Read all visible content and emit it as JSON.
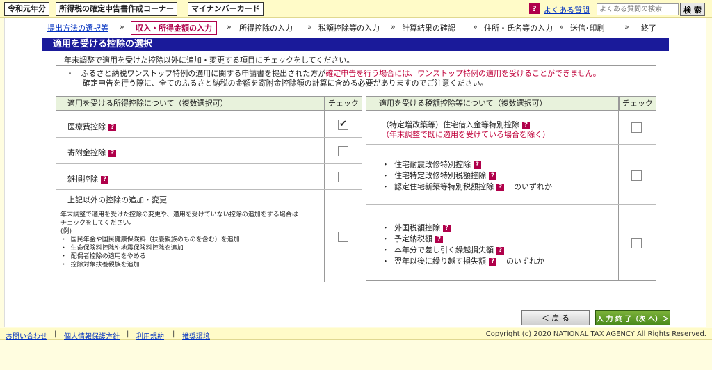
{
  "header": {
    "era_label": "令和元年分",
    "corner_label": "所得税の確定申告書作成コーナー",
    "mynumber_label": "マイナンバーカード",
    "faq_icon": "?",
    "faq_link": "よくある質問",
    "faq_search_placeholder": "よくある質問の検索",
    "search_button": "検 索"
  },
  "steps": {
    "s1": "提出方法の選択等",
    "s2": "収入・所得金額の入力",
    "s3": "所得控除の入力",
    "s4": "税額控除等の入力",
    "s5": "計算結果の確認",
    "s6": "住所・氏名等の入力",
    "s7": "送信･印刷",
    "s8": "終了",
    "sep": "»"
  },
  "section_title": "適用を受ける控除の選択",
  "intro": "年末調整で適用を受けた控除以外に追加・変更する項目にチェックをしてください。",
  "notice": {
    "bullet": "・",
    "line1a": "ふるさと納税ワンストップ特例の適用に関する申請書を提出された方が",
    "line1b": "確定申告を行う場合には、ワンストップ特例の適用を受けることができません。",
    "line2": "確定申告を行う際に、全てのふるさと納税の金額を寄附金控除額の計算に含める必要がありますのでご注意ください。"
  },
  "left_table": {
    "header": "適用を受ける所得控除について（複数選択可）",
    "check_header": "チェック",
    "rows": [
      {
        "label": "医療費控除",
        "checked": true
      },
      {
        "label": "寄附金控除",
        "checked": false
      },
      {
        "label": "雑損控除",
        "checked": false
      }
    ],
    "other_title": "上記以外の控除の追加・変更",
    "other_desc1": "年末調整で適用を受けた控除の変更や、適用を受けていない控除の追加をする場合は",
    "other_desc2": "チェックをしてください。",
    "other_example": "(例)",
    "other_items": [
      "国民年金や国民健康保険料（扶養親族のものを含む）を追加",
      "生命保険料控除や地震保険料控除を追加",
      "配偶者控除の適用をやめる",
      "控除対象扶養親族を追加"
    ],
    "other_checked": false
  },
  "right_table": {
    "header": "適用を受ける税額控除等について（複数選択可）",
    "check_header": "チェック",
    "row1_line1": "（特定増改築等）住宅借入金等特別控除",
    "row1_line2": "（年末調整で既に適用を受けている場合を除く）",
    "row2_items": [
      "住宅耐震改修特別控除",
      "住宅特定改修特別税額控除",
      "認定住宅新築等特別税額控除"
    ],
    "row2_suffix": "のいずれか",
    "row3_items": [
      "外国税額控除",
      "予定納税額",
      "本年分で差し引く繰越損失額",
      "翌年以後に繰り越す損失額"
    ],
    "row3_suffix": "のいずれか"
  },
  "buttons": {
    "back": "＜ 戻 る",
    "next": "入 力 終 了（次 へ）＞"
  },
  "footer": {
    "contact": "お問い合わせ",
    "privacy": "個人情報保護方針",
    "terms": "利用規約",
    "env": "推奨環境",
    "sep": "|",
    "copyright": "Copyright (c) 2020 NATIONAL TAX AGENCY All Rights Reserved."
  },
  "colors": {
    "accent_navy": "#1a1a9a",
    "alert_red": "#c0003a",
    "help_icon": "#b0004a",
    "next_green": "#5a9a26"
  }
}
